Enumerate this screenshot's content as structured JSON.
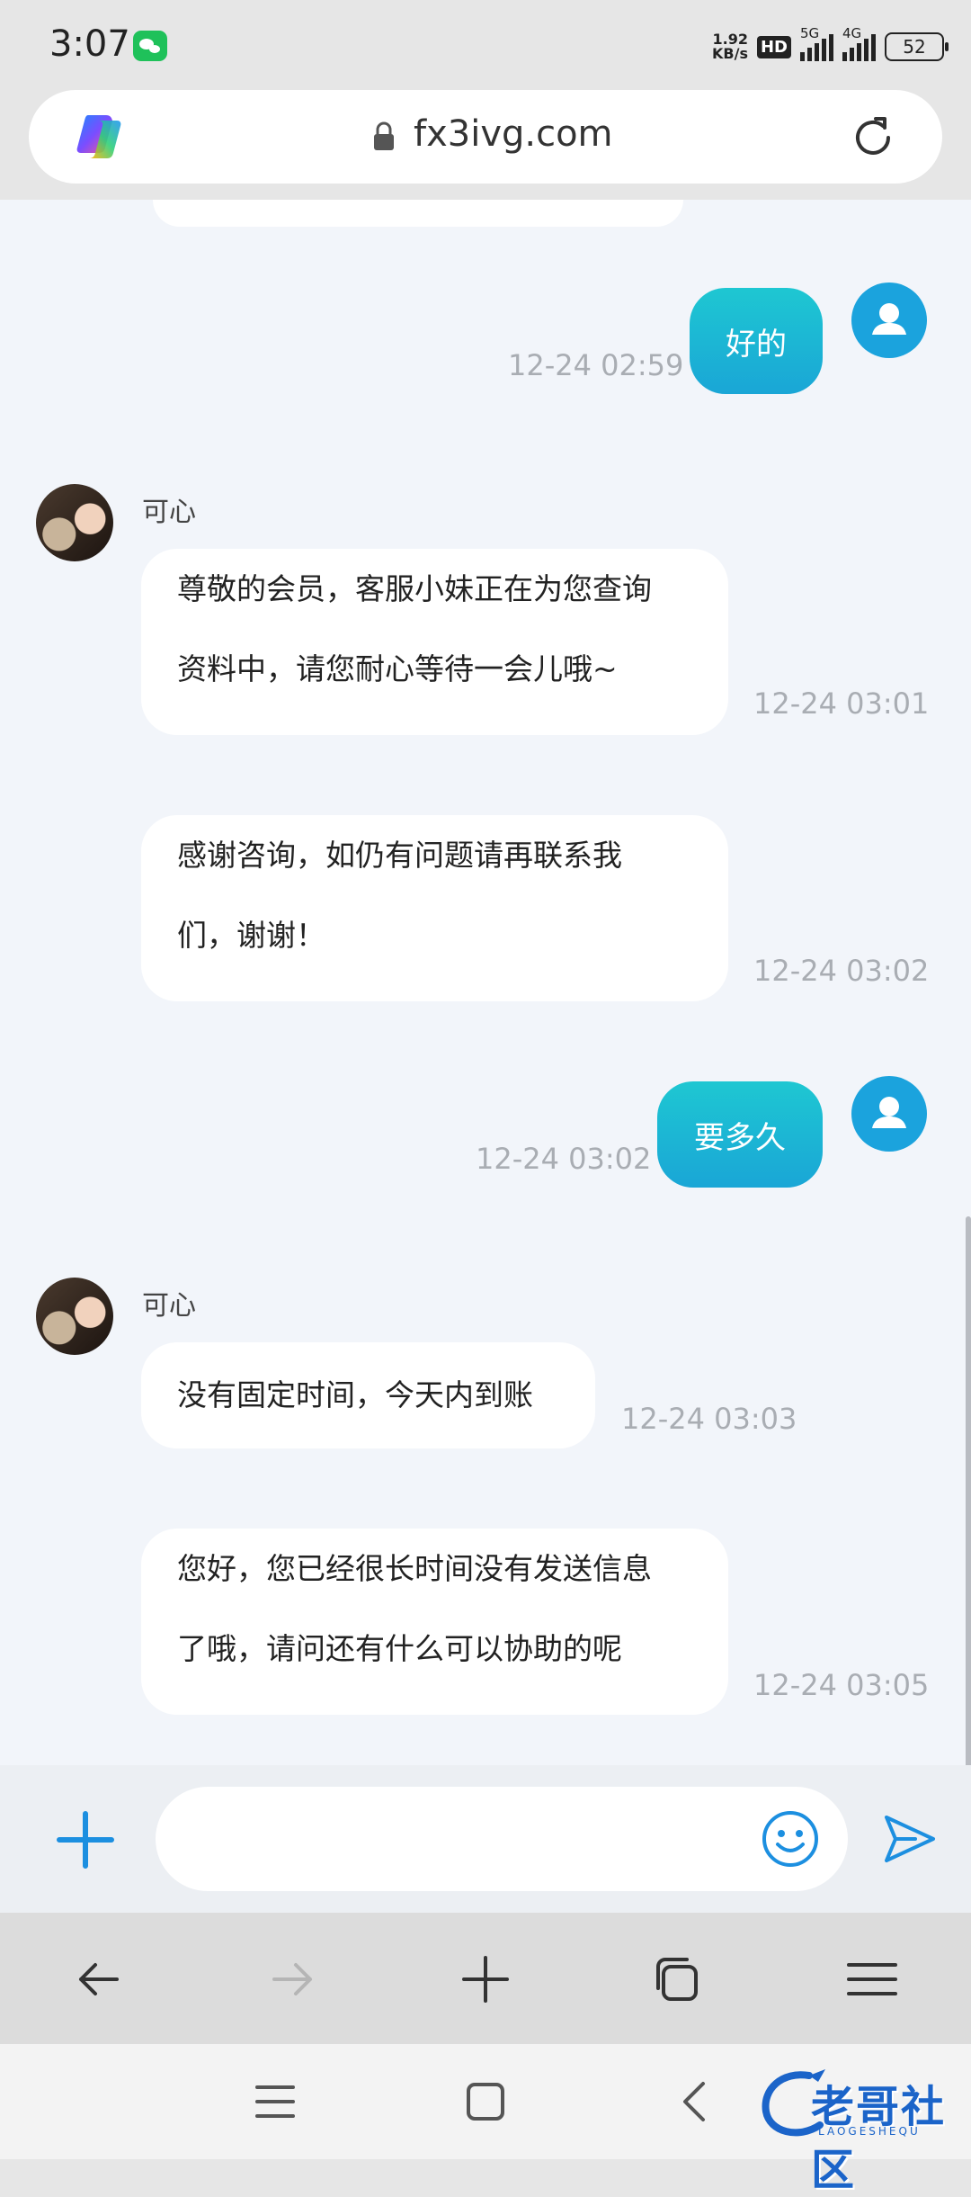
{
  "status_bar": {
    "time": "3:07",
    "net_speed_value": "1.92",
    "net_speed_unit": "KB/s",
    "hd_badge": "HD",
    "sim1_label": "5G",
    "sim2_label": "4G",
    "battery": "52"
  },
  "browser": {
    "url": "fx3ivg.com"
  },
  "chat": {
    "messages": [
      {
        "sender": "user",
        "text": "好的",
        "time": "12-24 02:59"
      },
      {
        "sender": "agent",
        "name": "可心",
        "text_line1": "尊敬的会员，客服小妹正在为您查询",
        "text_line2": "资料中，请您耐心等待一会儿哦~",
        "time": "12-24 03:01"
      },
      {
        "sender": "agent",
        "text_line1": "感谢咨询，如仍有问题请再联系我",
        "text_line2": "们，谢谢！",
        "time": "12-24 03:02"
      },
      {
        "sender": "user",
        "text": "要多久",
        "time": "12-24 03:02"
      },
      {
        "sender": "agent",
        "name": "可心",
        "text_line1": "没有固定时间，今天内到账",
        "time": "12-24 03:03"
      },
      {
        "sender": "agent",
        "text_line1": "您好，您已经很长时间没有发送信息",
        "text_line2": "了哦，请问还有什么可以协助的呢",
        "time": "12-24 03:05"
      }
    ]
  },
  "input": {
    "value": "",
    "placeholder": ""
  },
  "watermark": {
    "text": "老哥社区",
    "sub": "LAOGESHEQU"
  },
  "colors": {
    "accent": "#1ba3dd",
    "bubble_gradient_top": "#1ec7d2",
    "chat_bg": "#f2f5fa"
  }
}
